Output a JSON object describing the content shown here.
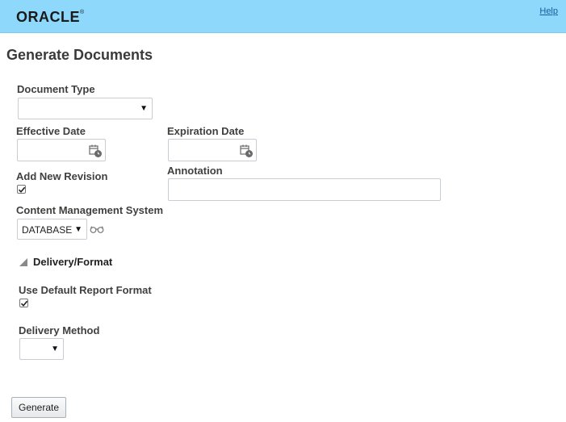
{
  "header": {
    "logo_text": "ORACLE",
    "logo_mark": "®",
    "help_label": "Help"
  },
  "page": {
    "title": "Generate Documents"
  },
  "form": {
    "document_type": {
      "label": "Document Type",
      "value": ""
    },
    "effective_date": {
      "label": "Effective Date",
      "value": ""
    },
    "expiration_date": {
      "label": "Expiration Date",
      "value": ""
    },
    "add_new_revision": {
      "label": "Add New Revision",
      "checked": true
    },
    "annotation": {
      "label": "Annotation",
      "value": ""
    },
    "content_management_system": {
      "label": "Content Management System",
      "value": "DATABASE"
    }
  },
  "delivery_format": {
    "title": "Delivery/Format",
    "expanded": true,
    "use_default_report_format": {
      "label": "Use Default Report Format",
      "checked": true
    },
    "delivery_method": {
      "label": "Delivery Method",
      "value": ""
    }
  },
  "actions": {
    "generate_label": "Generate"
  },
  "icons": {
    "calendar": "calendar-icon",
    "glasses": "glasses-icon",
    "checkmark": "checkmark-icon",
    "disclosure": "triangle-expanded-icon"
  },
  "colors": {
    "header_bg": "#8ed8fb",
    "link": "#145c9e",
    "field_border": "#c7cdd3"
  }
}
